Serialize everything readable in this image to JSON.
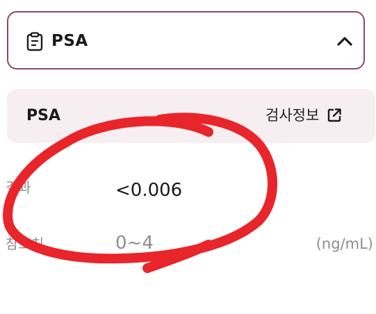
{
  "header": {
    "title": "PSA",
    "icon": "clipboard-icon",
    "toggle_icon": "chevron-up-icon",
    "border_color": "#8a4a62"
  },
  "info_card": {
    "title": "PSA",
    "link_label": "검사정보",
    "link_icon": "external-link-icon",
    "background": "#f6eef1"
  },
  "result": {
    "label": "결과",
    "value": "<0.006"
  },
  "reference": {
    "label": "참고치",
    "value": "0~4",
    "unit": "(ng/mL)"
  },
  "annotation": {
    "color": "#e8252b"
  }
}
